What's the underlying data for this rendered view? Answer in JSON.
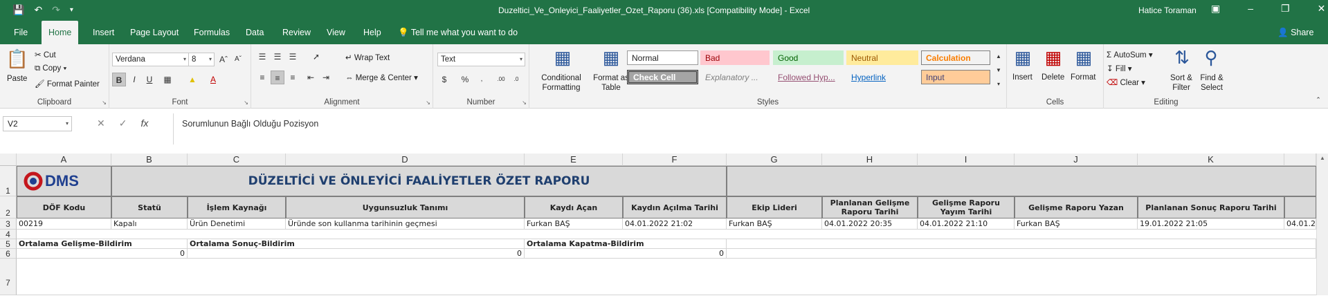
{
  "titlebar": {
    "title": "Duzeltici_Ve_Onleyici_Faaliyetler_Ozet_Raporu (36).xls  [Compatibility Mode]  -  Excel",
    "user": "Hatice Toraman"
  },
  "tabs": [
    "File",
    "Home",
    "Insert",
    "Page Layout",
    "Formulas",
    "Data",
    "Review",
    "View",
    "Help"
  ],
  "tellme": "Tell me what you want to do",
  "share": "Share",
  "ribbon": {
    "clipboard": {
      "paste": "Paste",
      "cut": "Cut",
      "copy": "Copy",
      "format_painter": "Format Painter",
      "label": "Clipboard"
    },
    "font": {
      "name": "Verdana",
      "size": "8",
      "label": "Font"
    },
    "alignment": {
      "wrap": "Wrap Text",
      "merge": "Merge & Center",
      "label": "Alignment"
    },
    "number": {
      "format": "Text",
      "label": "Number"
    },
    "styles": {
      "conditional": "Conditional Formatting",
      "format_table": "Format as Table",
      "normal": "Normal",
      "bad": "Bad",
      "good": "Good",
      "neutral": "Neutral",
      "calculation": "Calculation",
      "check_cell": "Check Cell",
      "explanatory": "Explanatory ...",
      "followed": "Followed Hyp...",
      "hyperlink": "Hyperlink",
      "input": "Input",
      "label": "Styles"
    },
    "cells": {
      "insert": "Insert",
      "delete": "Delete",
      "format": "Format",
      "label": "Cells"
    },
    "editing": {
      "autosum": "AutoSum",
      "fill": "Fill",
      "clear": "Clear",
      "sort": "Sort & Filter",
      "find": "Find & Select",
      "label": "Editing"
    }
  },
  "formula_bar": {
    "name_box": "V2",
    "content": "Sorumlunun Bağlı Olduğu Pozisyon"
  },
  "columns": [
    "A",
    "B",
    "C",
    "D",
    "E",
    "F",
    "G",
    "H",
    "I",
    "J",
    "K"
  ],
  "rows": [
    "1",
    "2",
    "3",
    "4",
    "5",
    "6",
    "7"
  ],
  "sheet": {
    "logo": "DMS",
    "report_title": "DÜZELTİCİ VE ÖNLEYİCİ FAALİYETLER ÖZET RAPORU",
    "headers": [
      "DÖF Kodu",
      "Statü",
      "İşlem Kaynağı",
      "Uygunsuzluk Tanımı",
      "Kaydı Açan",
      "Kaydın Açılma Tarihi",
      "Ekip Lideri",
      "Planlanan Gelişme Raporu Tarihi",
      "Gelişme Raporu Yayım Tarihi",
      "Gelişme Raporu Yazan",
      "Planlanan Sonuç Raporu Tarihi"
    ],
    "row3": [
      "00219",
      "Kapalı",
      "Ürün Denetimi",
      "Üründe son kullanma tarihinin geçmesi",
      "Furkan BAŞ",
      "04.01.2022 21:02",
      "Furkan BAŞ",
      "04.01.2022 20:35",
      "04.01.2022 21:10",
      "Furkan BAŞ",
      "19.01.2022 21:05",
      "04.01.2"
    ],
    "row5": {
      "a": "Ortalama Gelişme-Bildirim",
      "c": "Ortalama Sonuç-Bildirim",
      "e": "Ortalama Kapatma-Bildirim"
    },
    "row6": {
      "b": "0",
      "d": "0",
      "f": "0"
    }
  }
}
